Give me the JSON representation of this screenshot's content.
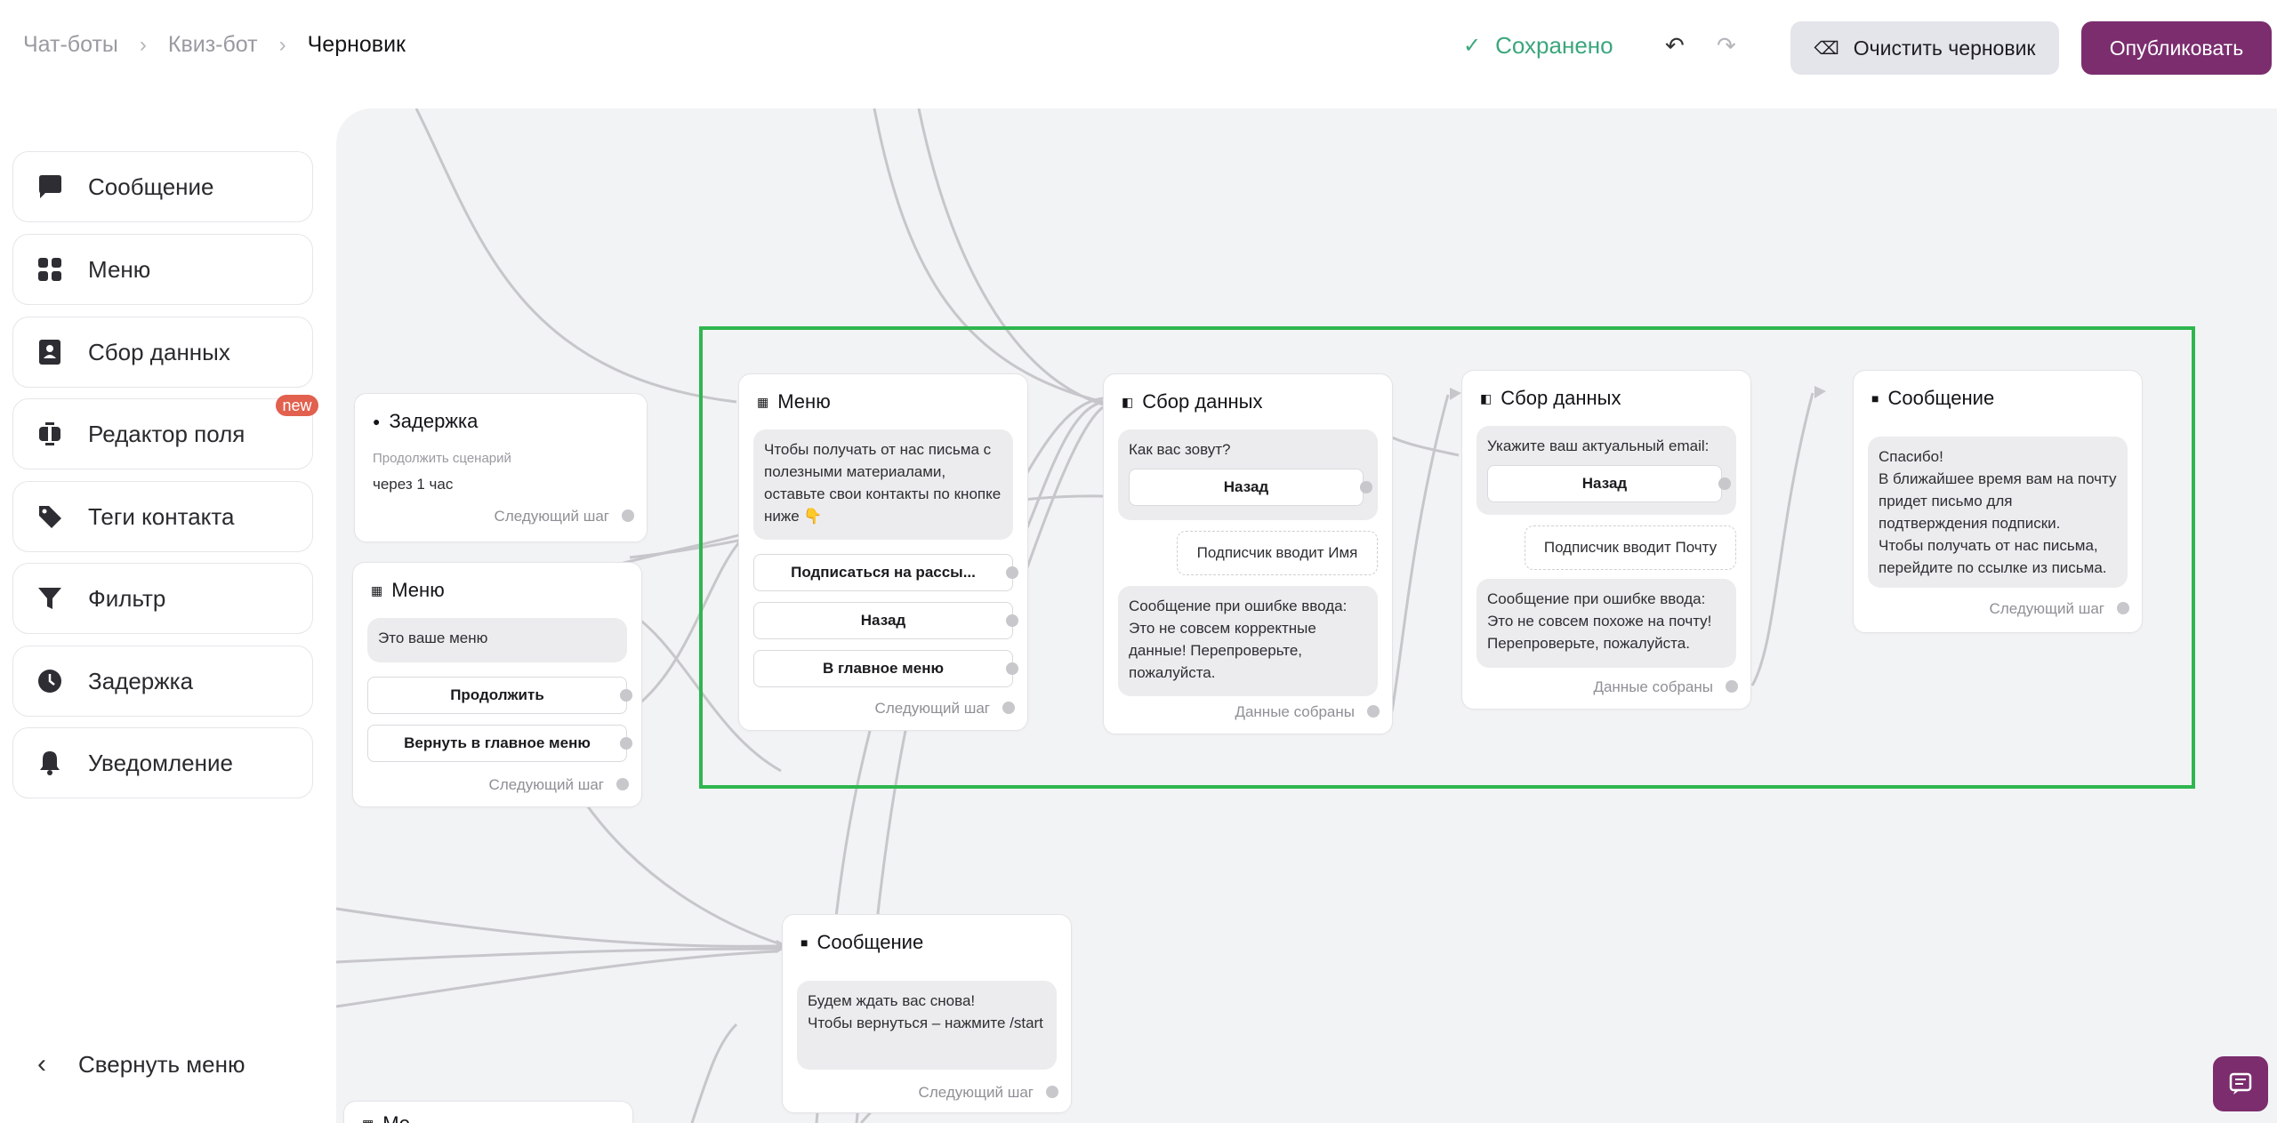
{
  "breadcrumb": {
    "items": [
      "Чат-боты",
      "Квиз-бот"
    ],
    "current": "Черновик",
    "separator": "›"
  },
  "header": {
    "saved_label": "Сохранено",
    "undo_icon": "↶",
    "redo_icon": "↷",
    "clear_label": "Очистить черновик",
    "publish_label": "Опубликовать"
  },
  "sidebar": {
    "items": [
      {
        "label": "Сообщение",
        "icon": "message-icon"
      },
      {
        "label": "Меню",
        "icon": "grid-icon"
      },
      {
        "label": "Сбор данных",
        "icon": "contact-card-icon"
      },
      {
        "label": "Редактор поля",
        "icon": "field-editor-icon"
      },
      {
        "label": "Теги контакта",
        "icon": "tag-icon"
      },
      {
        "label": "Фильтр",
        "icon": "filter-icon"
      },
      {
        "label": "Задержка",
        "icon": "clock-icon"
      },
      {
        "label": "Уведомление",
        "icon": "bell-icon"
      }
    ],
    "new_badge": "new",
    "collapse_label": "Свернуть меню"
  },
  "nodes": {
    "delay": {
      "title": "Задержка",
      "subtitle": "Продолжить сценарий",
      "value": "через 1 час",
      "footer": "Следующий шаг"
    },
    "menu_left": {
      "title": "Меню",
      "text": "Это ваше меню",
      "buttons": [
        "Продолжить",
        "Вернуть в главное меню"
      ],
      "footer": "Следующий шаг"
    },
    "menu_main": {
      "title": "Меню",
      "text": "Чтобы получать от нас письма с полезными материалами, оставьте свои контакты по кнопке ниже 👇",
      "buttons": [
        "Подписаться на рассы...",
        "Назад",
        "В главное меню"
      ],
      "footer": "Следующий шаг"
    },
    "collect_name": {
      "title": "Сбор данных",
      "question": "Как вас зовут?",
      "button": "Назад",
      "input": "Подписчик вводит Имя",
      "error": "Сообщение при ошибке ввода:\nЭто не совсем корректные данные! Перепроверьте, пожалуйста.",
      "footer": "Данные собраны"
    },
    "collect_email": {
      "title": "Сбор данных",
      "question": "Укажите ваш актуальный email:",
      "button": "Назад",
      "input": "Подписчик вводит Почту",
      "error": "Сообщение при ошибке ввода:\nЭто не совсем похоже на почту! Перепроверьте, пожалуйста.",
      "footer": "Данные собраны"
    },
    "message_thanks": {
      "title": "Сообщение",
      "text": "Спасибо!\nВ ближайшее время вам на почту придет письмо для подтверждения подписки.\nЧтобы получать от нас письма, перейдите по ссылке из письма.",
      "footer": "Следующий шаг"
    },
    "message_bottom": {
      "title": "Сообщение",
      "text": "Будем ждать вас снова!\nЧтобы вернуться – нажмите /start",
      "footer": "Следующий шаг"
    },
    "partial_bottom": {
      "title": "Ме"
    }
  },
  "colors": {
    "accent": "#7b2d6e",
    "saved": "#3ba77c",
    "highlight": "#2fb64f",
    "new_badge": "#e2604e",
    "canvas": "#f2f3f5"
  }
}
